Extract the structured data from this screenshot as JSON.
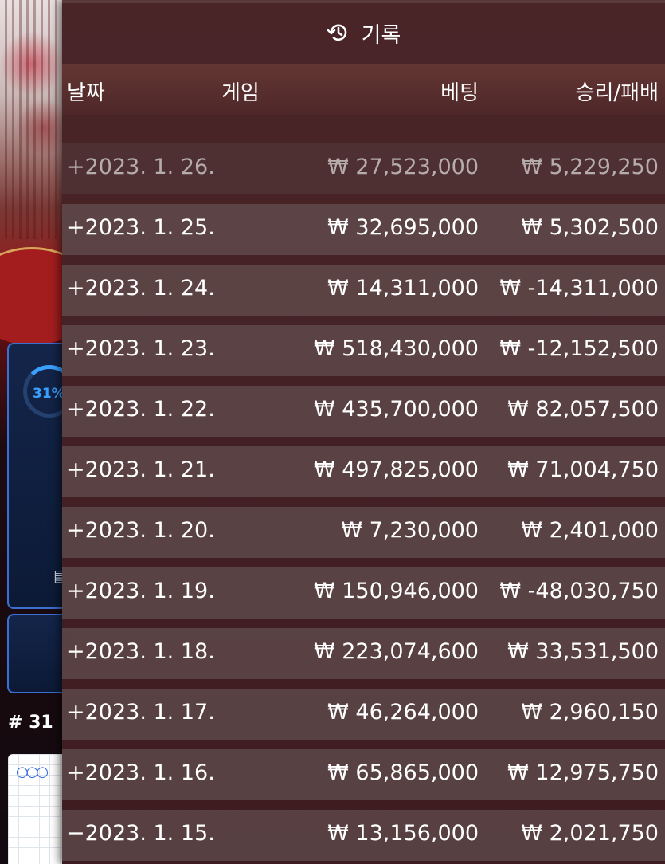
{
  "background": {
    "progress_label": "31%",
    "progress": 0.31,
    "round_label": "# 31"
  },
  "header": {
    "icon": "history-icon",
    "title": "기록"
  },
  "columns": {
    "date": "날짜",
    "game": "게임",
    "bet": "베팅",
    "win_loss": "승리/패배"
  },
  "rows": [
    {
      "date": "+2023. 1. 26.",
      "bet": "₩ 27,523,000",
      "win_loss": "₩ 5,229,250"
    },
    {
      "date": "+2023. 1. 25.",
      "bet": "₩ 32,695,000",
      "win_loss": "₩ 5,302,500"
    },
    {
      "date": "+2023. 1. 24.",
      "bet": "₩ 14,311,000",
      "win_loss": "₩ -14,311,000"
    },
    {
      "date": "+2023. 1. 23.",
      "bet": "₩ 518,430,000",
      "win_loss": "₩ -12,152,500"
    },
    {
      "date": "+2023. 1. 22.",
      "bet": "₩ 435,700,000",
      "win_loss": "₩ 82,057,500"
    },
    {
      "date": "+2023. 1. 21.",
      "bet": "₩ 497,825,000",
      "win_loss": "₩ 71,004,750"
    },
    {
      "date": "+2023. 1. 20.",
      "bet": "₩ 7,230,000",
      "win_loss": "₩ 2,401,000"
    },
    {
      "date": "+2023. 1. 19.",
      "bet": "₩ 150,946,000",
      "win_loss": "₩ -48,030,750"
    },
    {
      "date": "+2023. 1. 18.",
      "bet": "₩ 223,074,600",
      "win_loss": "₩ 33,531,500"
    },
    {
      "date": "+2023. 1. 17.",
      "bet": "₩ 46,264,000",
      "win_loss": "₩ 2,960,150"
    },
    {
      "date": "+2023. 1. 16.",
      "bet": "₩ 65,865,000",
      "win_loss": "₩ 12,975,750"
    },
    {
      "date": "−2023. 1. 15.",
      "bet": "₩ 13,156,000",
      "win_loss": "₩ 2,021,750"
    }
  ]
}
